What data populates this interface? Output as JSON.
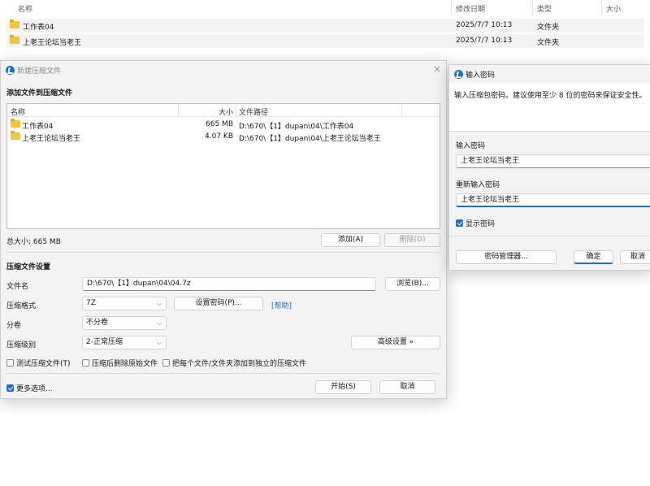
{
  "explorer": {
    "columns": {
      "name": "名称",
      "date": "修改日期",
      "type": "类型",
      "size": "大小"
    },
    "sort_indicator": "^",
    "rows": [
      {
        "name": "工作表04",
        "date": "2025/7/7 10:13",
        "type": "文件夹"
      },
      {
        "name": "上老王论坛当老王",
        "date": "2025/7/7 10:13",
        "type": "文件夹"
      }
    ]
  },
  "main_dialog": {
    "title": "新建压缩文件",
    "close": "×",
    "add_section_title": "添加文件到压缩文件",
    "list": {
      "columns": {
        "name": "名称",
        "size": "大小",
        "path": "文件路径"
      },
      "rows": [
        {
          "name": "工作表04",
          "size": "665 MB",
          "path": "D:\\670\\【1】dupan\\04\\工作表04"
        },
        {
          "name": "上老王论坛当老王",
          "size": "4.07 KB",
          "path": "D:\\670\\【1】dupan\\04\\上老王论坛当老王"
        }
      ]
    },
    "total_size": "总大小: 665 MB",
    "add_button": "添加(A)",
    "delete_button": "删除(D)",
    "settings_title": "压缩文件设置",
    "filename_label": "文件名",
    "filename_value": "D:\\670\\【1】dupan\\04\\04.7z",
    "browse_button": "浏览(B)...",
    "format_label": "压缩格式",
    "format_value": "7Z",
    "set_password_button": "设置密码(P)...",
    "help_link": "[帮助]",
    "volume_label": "分卷",
    "volume_value": "不分卷",
    "level_label": "压缩级别",
    "level_value": "2-正常压缩",
    "advanced_button": "高级设置 »",
    "test_checkbox": "测试压缩文件(T)",
    "delete_after_checkbox": "压缩后删除原始文件",
    "separate_checkbox": "把每个文件/文件夹添加到独立的压缩文件",
    "more_options_checkbox": "更多选项...",
    "start_button": "开始(S)",
    "cancel_button": "取消"
  },
  "password_dialog": {
    "title": "输入密码",
    "info": "输入压缩包密码。建议使用至少 8 位的密码来保证安全性。",
    "password_label": "输入密码",
    "password_value": "上老王论坛当老王",
    "repeat_label": "重新输入密码",
    "repeat_value": "上老王论坛当老王",
    "show_password_checkbox": "显示密码",
    "manager_button": "密码管理器...",
    "ok_button": "确定",
    "cancel_button": "取消"
  },
  "colors": {
    "accent": "#1f6fd1",
    "folder": "#f4c542"
  }
}
